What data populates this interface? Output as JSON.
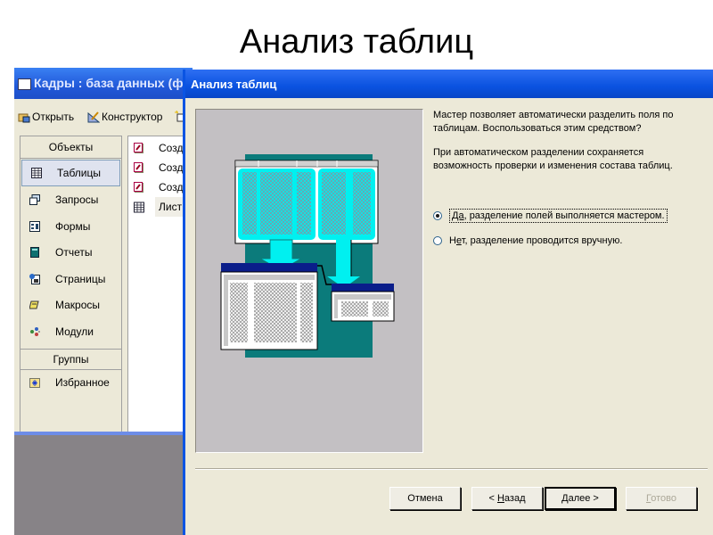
{
  "slide": {
    "title": "Анализ таблиц"
  },
  "background_window": {
    "title": "Кадры : база данных (фо",
    "toolbar": [
      {
        "label": "Открыть",
        "icon": "open-icon"
      },
      {
        "label": "Конструктор",
        "icon": "design-icon"
      }
    ],
    "objects_header": "Объекты",
    "objects": [
      {
        "label": "Таблицы",
        "icon": "table-icon",
        "selected": true
      },
      {
        "label": "Запросы",
        "icon": "query-icon"
      },
      {
        "label": "Формы",
        "icon": "form-icon"
      },
      {
        "label": "Отчеты",
        "icon": "report-icon"
      },
      {
        "label": "Страницы",
        "icon": "page-icon"
      },
      {
        "label": "Макросы",
        "icon": "macro-icon"
      },
      {
        "label": "Модули",
        "icon": "module-icon"
      }
    ],
    "groups_header": "Группы",
    "groups": [
      {
        "label": "Избранное",
        "icon": "favorites-icon"
      }
    ],
    "list_items": [
      {
        "label": "Созд",
        "icon": "wizard-icon"
      },
      {
        "label": "Созд",
        "icon": "wizard-icon"
      },
      {
        "label": "Созд",
        "icon": "wizard-icon"
      },
      {
        "label": "Лист",
        "icon": "table-icon"
      }
    ]
  },
  "dialog": {
    "title": "Анализ таблиц",
    "description_1": "Мастер позволяет автоматически разделить поля по таблицам. Воспользоваться этим средством?",
    "description_2": "При автоматическом разделении сохраняется возможность проверки и изменения состава таблиц.",
    "options": [
      {
        "hotkey": "Да",
        "rest": ", разделение полей выполняется мастером.",
        "selected": true
      },
      {
        "hotkey_pre": "Н",
        "hotkey": "е",
        "rest": "т, разделение проводится вручную.",
        "selected": false
      }
    ],
    "buttons": {
      "cancel": "Отмена",
      "back_prefix": "< ",
      "back_hotkey": "Н",
      "back_rest": "азад",
      "next_hotkey": "Д",
      "next_rest": "алее >",
      "finish_hotkey": "Г",
      "finish_rest": "отово"
    },
    "illustration": {
      "cell_text_short": "XXX",
      "cell_text_mid": "XXXX",
      "cell_text_long": "XXXXXXX",
      "cell_text_xl": "XXXXXXXXX",
      "cell_text_6": "XXXXXX"
    }
  }
}
